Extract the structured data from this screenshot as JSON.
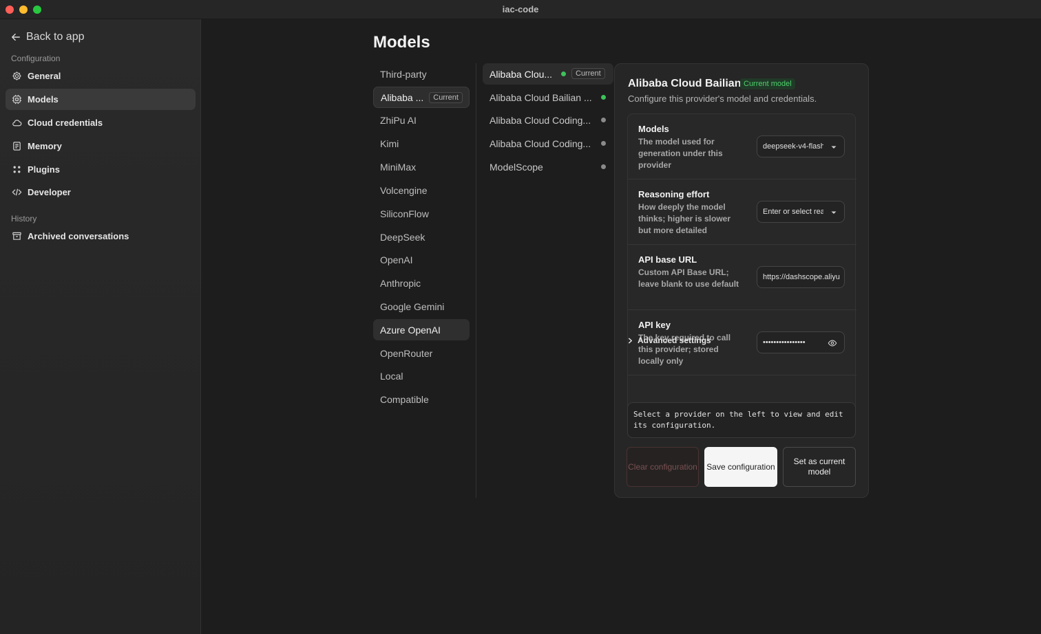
{
  "window": {
    "title": "iac-code"
  },
  "sidebar": {
    "back_label": "Back to app",
    "config_label": "Configuration",
    "items": [
      {
        "label": "General",
        "icon": "gear-icon"
      },
      {
        "label": "Models",
        "icon": "cpu-icon"
      },
      {
        "label": "Cloud credentials",
        "icon": "cloud-icon"
      },
      {
        "label": "Memory",
        "icon": "document-icon"
      },
      {
        "label": "Plugins",
        "icon": "grid-icon"
      },
      {
        "label": "Developer",
        "icon": "code-icon"
      }
    ],
    "history_label": "History",
    "history_items": [
      {
        "label": "Archived conversations",
        "icon": "archive-icon"
      }
    ]
  },
  "page": {
    "title": "Models"
  },
  "providers": {
    "badge": "Current",
    "items": [
      "Third-party",
      "Alibaba ...",
      "ZhiPu AI",
      "Kimi",
      "MiniMax",
      "Volcengine",
      "SiliconFlow",
      "DeepSeek",
      "OpenAI",
      "Anthropic",
      "Google Gemini",
      "Azure OpenAI",
      "OpenRouter",
      "Local",
      "Compatible"
    ]
  },
  "sub_providers": {
    "badge": "Current",
    "items": [
      {
        "label": "Alibaba Clou...",
        "status": "active"
      },
      {
        "label": "Alibaba Cloud Bailian ...",
        "status": "active"
      },
      {
        "label": "Alibaba Cloud Coding...",
        "status": "inactive"
      },
      {
        "label": "Alibaba Cloud Coding...",
        "status": "inactive"
      },
      {
        "label": "ModelScope",
        "status": "inactive"
      }
    ]
  },
  "detail": {
    "title": "Alibaba Cloud Bailian",
    "current_badge": "Current model",
    "description": "Configure this provider's model and credentials.",
    "fields": {
      "models": {
        "title": "Models",
        "desc": "The model used for generation under this provider",
        "value": "deepseek-v4-flash"
      },
      "reasoning": {
        "title": "Reasoning effort",
        "desc": "How deeply the model thinks; higher is slower but more detailed",
        "placeholder": "Enter or select reasoning effort"
      },
      "api_base": {
        "title": "API base URL",
        "desc": "Custom API Base URL; leave blank to use default",
        "value": "https://dashscope.aliyuncs.com"
      },
      "api_key": {
        "title": "API key",
        "desc": "The key required to call this provider; stored locally only",
        "value": "••••••••••••••••"
      }
    },
    "advanced_label": "Advanced settings",
    "info_text": "Select a provider on the left to view and edit its configuration.",
    "buttons": {
      "clear": "Clear configuration",
      "save": "Save configuration",
      "set_current": "Set as current model"
    }
  },
  "colors": {
    "accent_green": "#3ec25a",
    "background": "#1d1d1d",
    "sidebar": "#262626"
  }
}
